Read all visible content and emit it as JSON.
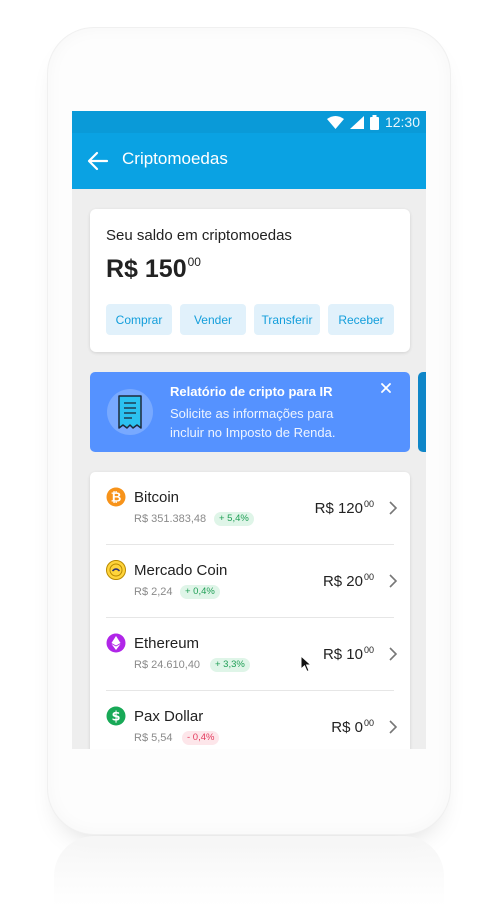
{
  "statusbar": {
    "time": "12:30",
    "icons": [
      "wifi-icon",
      "signal-icon",
      "battery-icon"
    ]
  },
  "appbar": {
    "title": "Criptomoedas",
    "back_icon": "back-arrow-icon"
  },
  "balance": {
    "title": "Seu saldo em criptomoedas",
    "amount": "R$ 150",
    "cents": "00",
    "actions": [
      "Comprar",
      "Vender",
      "Transferir",
      "Receber"
    ]
  },
  "banner": {
    "title": "Relatório de cripto para IR",
    "text": "Solicite as informações para incluir no Imposto de Renda.",
    "icon": "receipt-icon",
    "close_icon": "close-icon"
  },
  "coins": [
    {
      "name": "Bitcoin",
      "price": "R$ 351.383,48",
      "change": "+ 5,4%",
      "direction": "up",
      "value": "R$ 120",
      "cents": "00",
      "icon": "bitcoin-icon",
      "color": "#f7931a"
    },
    {
      "name": "Mercado Coin",
      "price": "R$ 2,24",
      "change": "+ 0,4%",
      "direction": "up",
      "value": "R$ 20",
      "cents": "00",
      "icon": "mercado-coin-icon",
      "color": "#ffd43b"
    },
    {
      "name": "Ethereum",
      "price": "R$ 24.610,40",
      "change": "+ 3,3%",
      "direction": "up",
      "value": "R$ 10",
      "cents": "00",
      "icon": "ethereum-icon",
      "color": "#b026e8"
    },
    {
      "name": "Pax Dollar",
      "price": "R$ 5,54",
      "change": "- 0,4%",
      "direction": "down",
      "value": "R$ 0",
      "cents": "00",
      "icon": "pax-dollar-icon",
      "color": "#18a957"
    }
  ],
  "colors": {
    "primary": "#0aa2e3",
    "banner": "#5592ff",
    "accent_text": "#139edb"
  }
}
